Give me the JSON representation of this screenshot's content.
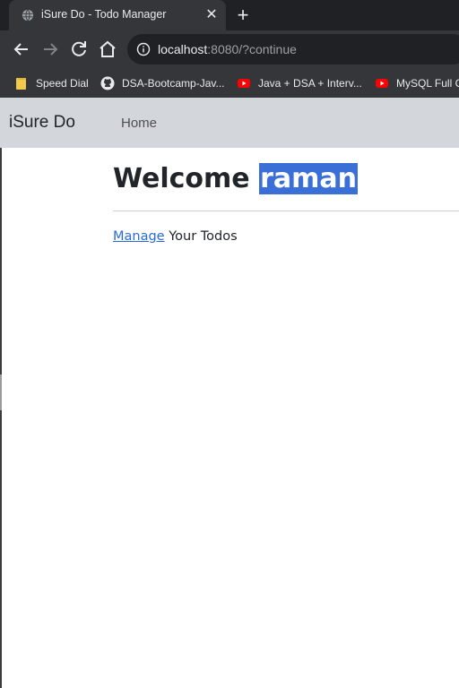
{
  "browser": {
    "tab": {
      "title": "iSure Do - Todo Manager",
      "close_glyph": "✕",
      "favicon": "globe-icon"
    },
    "new_tab_glyph": "+",
    "toolbar": {
      "back": "arrow-left-icon",
      "forward": "arrow-right-icon",
      "reload": "reload-icon",
      "home": "home-icon"
    },
    "address": {
      "host": "localhost",
      "rest": ":8080/?continue",
      "info_icon": "info-icon"
    },
    "bookmarks": [
      {
        "label": "Speed Dial",
        "icon": "folder-icon"
      },
      {
        "label": "DSA-Bootcamp-Jav...",
        "icon": "github-icon"
      },
      {
        "label": "Java + DSA + Interv...",
        "icon": "youtube-icon"
      },
      {
        "label": "MySQL Full C",
        "icon": "youtube-icon"
      }
    ],
    "colors": {
      "chrome": "#35363a",
      "tabstrip": "#202124",
      "youtube_red": "#ff0000",
      "folder_yellow": "#f2c94c"
    }
  },
  "app": {
    "brand": "iSure Do",
    "nav": {
      "home": "Home"
    },
    "welcome": {
      "prefix": "Welcome",
      "username": "raman"
    },
    "manage": {
      "link": "Manage",
      "suffix": "Your Todos"
    },
    "colors": {
      "navbar": "#d3d6db",
      "selection": "#3a6fd8",
      "link": "#2a6ad8"
    }
  }
}
